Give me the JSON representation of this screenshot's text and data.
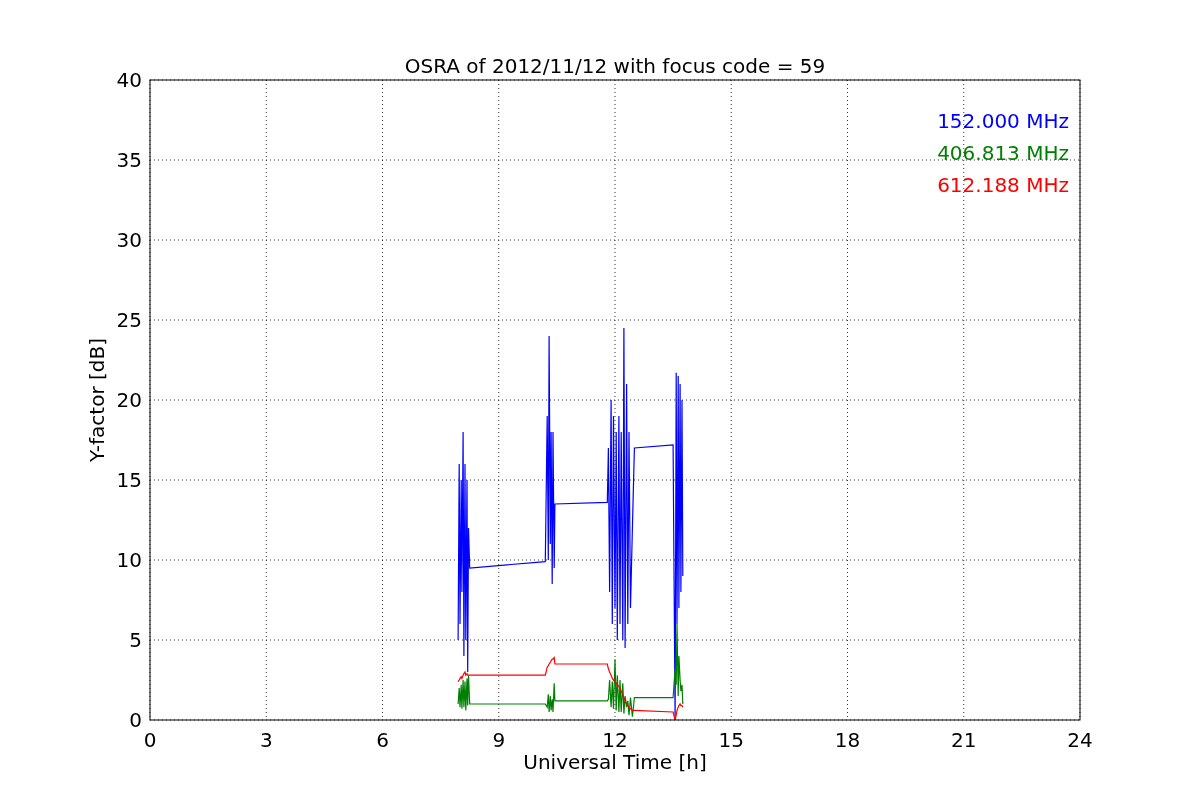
{
  "chart_data": {
    "type": "line",
    "grid": true,
    "title": "OSRA of 2012/11/12 with focus code = 59",
    "xlabel": "Universal Time [h]",
    "ylabel": "Y-factor [dB]",
    "xlim": [
      0,
      24
    ],
    "ylim": [
      0,
      40
    ],
    "xticks": [
      0,
      3,
      6,
      9,
      12,
      15,
      18,
      21,
      24
    ],
    "yticks": [
      0,
      5,
      10,
      15,
      20,
      25,
      30,
      35,
      40
    ],
    "x": [
      7.95,
      7.98,
      8.0,
      8.03,
      8.05,
      8.08,
      8.1,
      8.13,
      8.15,
      8.18,
      8.2,
      8.22,
      8.25,
      10.2,
      10.25,
      10.28,
      10.3,
      10.33,
      10.35,
      10.38,
      10.4,
      10.43,
      10.45,
      11.8,
      11.83,
      11.86,
      11.9,
      11.93,
      11.96,
      12.0,
      12.03,
      12.06,
      12.1,
      12.13,
      12.16,
      12.2,
      12.23,
      12.26,
      12.3,
      12.33,
      12.36,
      12.4,
      12.45,
      12.5,
      13.5,
      13.55,
      13.58,
      13.6,
      13.63,
      13.65,
      13.68,
      13.7,
      13.73,
      13.75
    ],
    "series": [
      {
        "name": "152.000 MHz",
        "color": "#0000ff",
        "values": [
          5,
          16,
          6,
          15,
          8,
          18,
          4,
          16,
          5,
          15,
          3,
          12,
          9.5,
          9.9,
          19,
          10,
          24,
          11,
          18,
          8.5,
          18,
          9.5,
          13.5,
          13.6,
          17,
          8,
          20,
          6,
          19,
          7,
          18,
          5,
          19,
          6,
          18,
          5,
          24.5,
          4.5,
          21,
          6,
          18,
          7,
          12,
          17,
          17.2,
          0,
          21.7,
          6,
          21.5,
          7,
          21,
          8,
          20,
          9
        ]
      },
      {
        "name": "406.813 MHz",
        "color": "#008000",
        "values": [
          1,
          2,
          0.8,
          2.2,
          0.7,
          2.5,
          0.8,
          2.4,
          0.6,
          2.6,
          0.9,
          2.8,
          1.0,
          1.0,
          0.8,
          1.6,
          0.5,
          1.5,
          0.6,
          1.3,
          0.5,
          2.3,
          1.2,
          1.2,
          1.3,
          2.5,
          0.8,
          2.4,
          0.7,
          3.8,
          0.6,
          2.8,
          0.5,
          2.5,
          0.5,
          2.3,
          0.4,
          1.5,
          0.8,
          1.2,
          0.3,
          1.4,
          0.2,
          1.4,
          1.4,
          3.2,
          2.2,
          6,
          1.5,
          4,
          2.5,
          1.8,
          2.2,
          1.0
        ]
      },
      {
        "name": "612.188 MHz",
        "color": "#ff0000",
        "values": [
          2.4,
          2.5,
          2.6,
          2.7,
          2.6,
          2.8,
          2.9,
          3.0,
          2.8,
          2.9,
          2.8,
          2.8,
          2.8,
          2.8,
          3.3,
          3.4,
          3.5,
          3.6,
          3.7,
          3.8,
          3.8,
          3.9,
          3.5,
          3.5,
          3.2,
          3.0,
          2.8,
          2.6,
          2.5,
          2.4,
          2.3,
          2.2,
          2.1,
          2.0,
          1.8,
          1.6,
          1.4,
          1.2,
          1.0,
          0.9,
          0.8,
          0.7,
          0.6,
          0.6,
          0.5,
          0.0,
          0.3,
          0.6,
          0.8,
          0.9,
          1.0,
          0.9,
          0.9,
          0.8
        ]
      }
    ]
  }
}
